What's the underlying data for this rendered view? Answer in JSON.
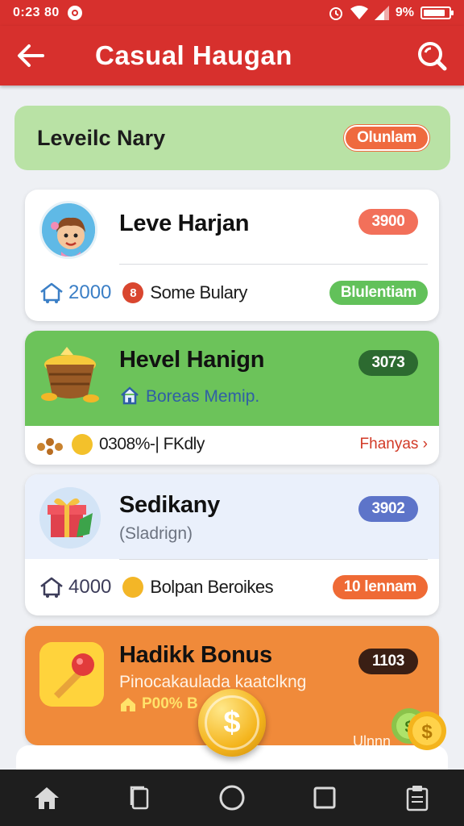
{
  "status_bar": {
    "time": "0:23 80",
    "battery_text": "9%",
    "battery_level": 0.85
  },
  "header": {
    "title": "Casual Haugan",
    "back_icon": "arrow-left-icon",
    "search_icon": "search-icon"
  },
  "banner": {
    "label": "Leveilc Nary",
    "pill": "Olunlam"
  },
  "cards": [
    {
      "name": "Leve Harjan",
      "badge": "3900",
      "stat": "2000",
      "coin_mark": "8",
      "desc": "Some Bulary",
      "action": "Blulentiam"
    },
    {
      "name": "Hevel Hanign",
      "badge": "3073",
      "sub": "Boreas Memip.",
      "desc": "0308%-| FKdly",
      "action": "Fhanyas ›"
    },
    {
      "name": "Sedikany",
      "badge": "3902",
      "sub": "(Sladrign)",
      "stat": "4000",
      "desc": "Bolpan Beroikes",
      "action": "10 lennam"
    },
    {
      "name": "Hadikk Bonus",
      "badge": "1103",
      "sub": "Pinocakaulada kaatclkng",
      "promo": "P00% B",
      "foot": "Ulnnn"
    }
  ],
  "colors": {
    "header": "#d7302d",
    "banner": "#b9e2a5",
    "card_green": "#6cc35a",
    "card_orange": "#f08a3a"
  }
}
